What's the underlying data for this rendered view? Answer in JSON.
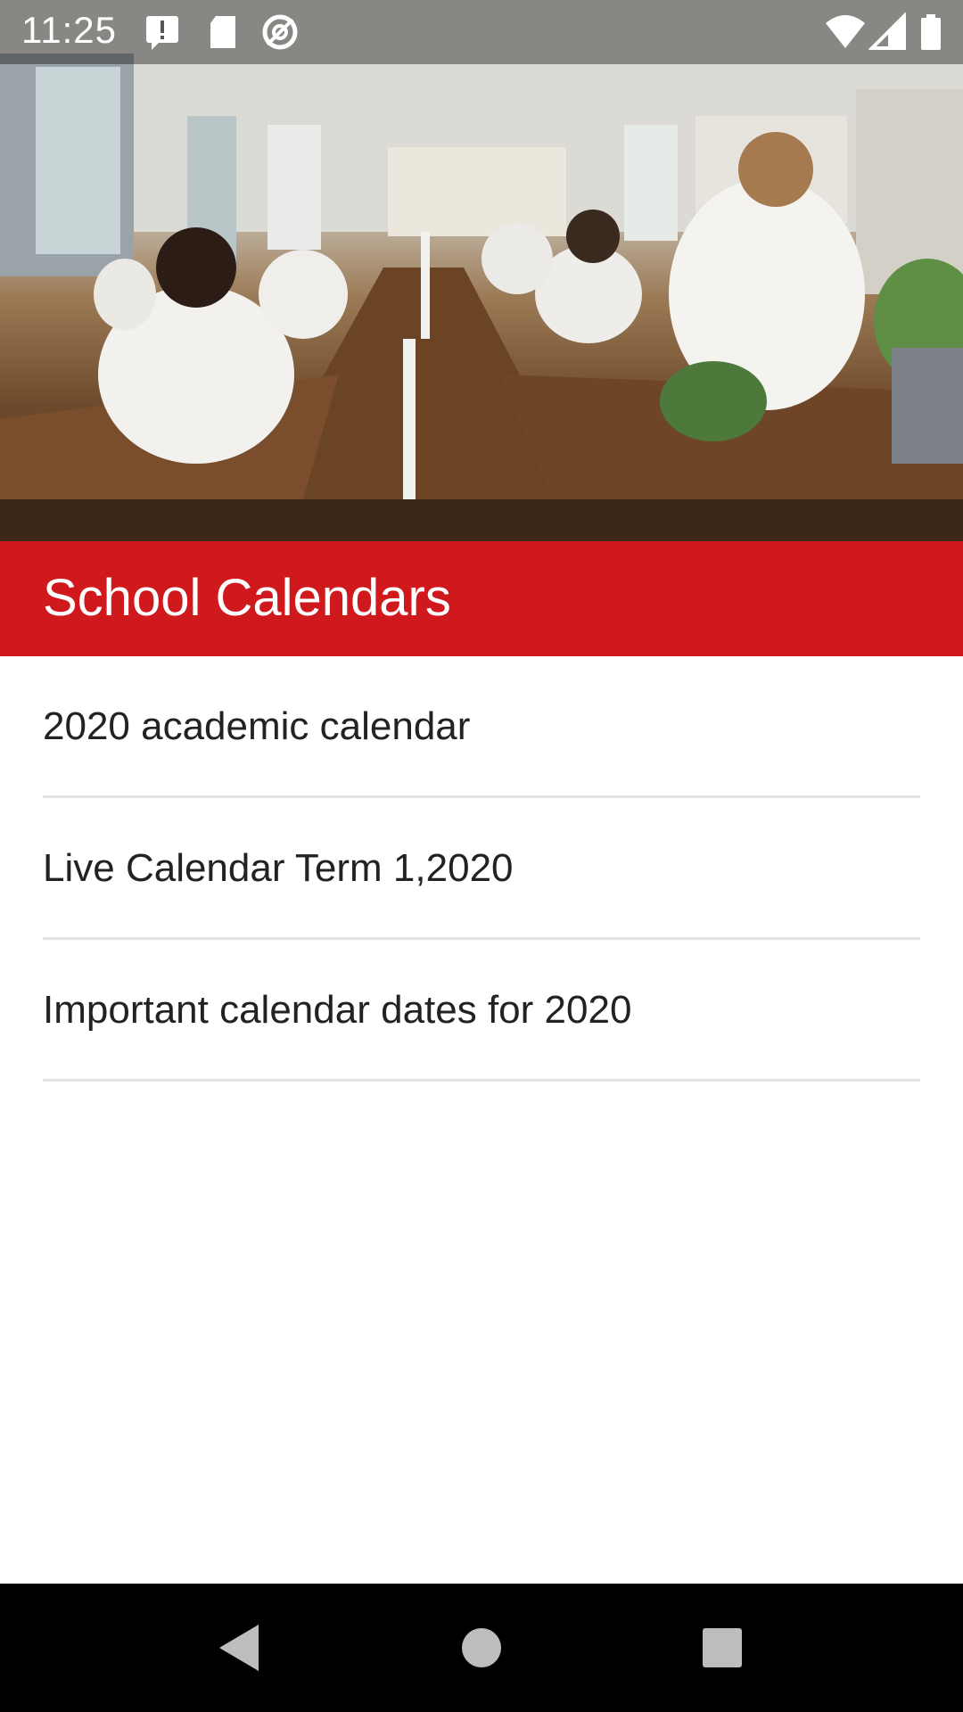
{
  "status_bar": {
    "time": "11:25",
    "left_icons": [
      "alert-icon",
      "sd-card-icon",
      "at-sign-icon"
    ],
    "right_icons": [
      "wifi-icon",
      "signal-icon",
      "battery-icon"
    ]
  },
  "hero": {
    "image": "classroom-photo",
    "scene": "students in lab coats at wooden benches"
  },
  "header": {
    "title": "School Calendars",
    "color": "#d0191d"
  },
  "calendars": [
    {
      "label": "2020 academic calendar"
    },
    {
      "label": "Live Calendar Term 1,2020"
    },
    {
      "label": "Important calendar dates for 2020"
    }
  ],
  "nav_bar": {
    "buttons": [
      "back-icon",
      "home-icon",
      "recents-icon"
    ]
  }
}
